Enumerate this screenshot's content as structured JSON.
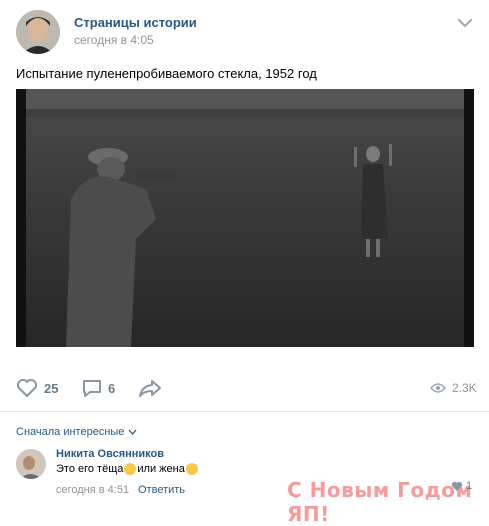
{
  "post": {
    "author": "Страницы истории",
    "time": "сегодня в 4:05",
    "text": "Испытание пуленепробиваемого стекла, 1952 год"
  },
  "actions": {
    "likes": "25",
    "comments": "6",
    "views": "2.3K"
  },
  "comments_section": {
    "sort_label": "Сначала интересные",
    "comment": {
      "author": "Никита Овсянников",
      "text_part1": "Это его тёща",
      "text_part2": "или жена",
      "time": "сегодня в 4:51",
      "reply": "Ответить",
      "likes": "1"
    }
  },
  "watermark": "С Новым Годом ЯП!",
  "colors": {
    "link": "#2a5885",
    "meta": "#939393",
    "icon": "#6b7a8b",
    "watermark": "#ef4b49"
  }
}
